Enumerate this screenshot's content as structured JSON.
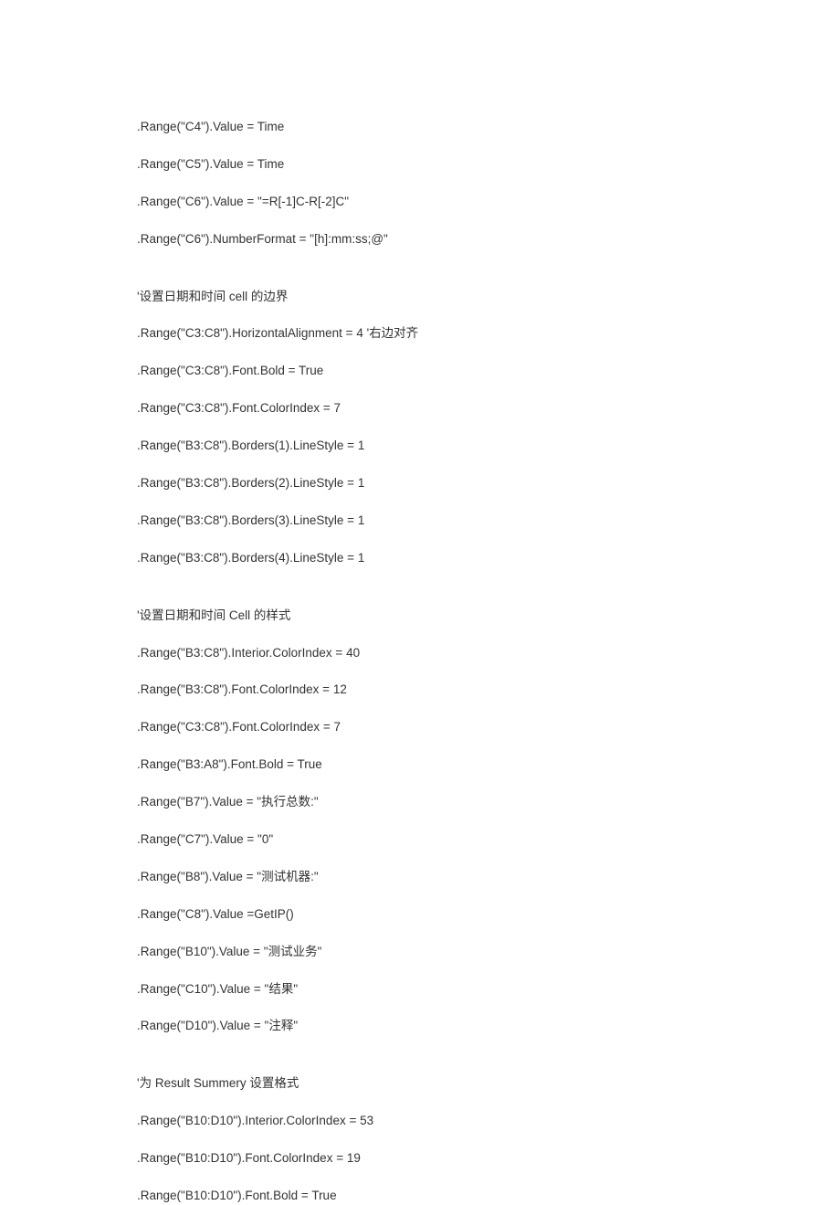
{
  "lines": [
    ".Range(\"C4\").Value = Time",
    ".Range(\"C5\").Value = Time",
    ".Range(\"C6\").Value = \"=R[-1]C-R[-2]C\"",
    ".Range(\"C6\").NumberFormat = \"[h]:mm:ss;@\"",
    "",
    "'设置日期和时间 cell 的边界",
    ".Range(\"C3:C8\").HorizontalAlignment = 4 '右边对齐",
    ".Range(\"C3:C8\").Font.Bold = True",
    ".Range(\"C3:C8\").Font.ColorIndex = 7",
    ".Range(\"B3:C8\").Borders(1).LineStyle = 1",
    ".Range(\"B3:C8\").Borders(2).LineStyle = 1",
    ".Range(\"B3:C8\").Borders(3).LineStyle = 1",
    ".Range(\"B3:C8\").Borders(4).LineStyle = 1",
    "",
    "'设置日期和时间 Cell 的样式",
    ".Range(\"B3:C8\").Interior.ColorIndex = 40",
    ".Range(\"B3:C8\").Font.ColorIndex = 12",
    ".Range(\"C3:C8\").Font.ColorIndex = 7",
    ".Range(\"B3:A8\").Font.Bold = True",
    ".Range(\"B7\").Value = \"执行总数:\"",
    ".Range(\"C7\").Value = \"0\"",
    ".Range(\"B8\").Value = \"测试机器:\"",
    ".Range(\"C8\").Value =GetIP()",
    ".Range(\"B10\").Value = \"测试业务\"",
    ".Range(\"C10\").Value = \"结果\"",
    ".Range(\"D10\").Value = \"注释\"",
    "",
    "'为 Result Summery 设置格式",
    ".Range(\"B10:D10\").Interior.ColorIndex = 53",
    ".Range(\"B10:D10\").Font.ColorIndex = 19",
    ".Range(\"B10:D10\").Font.Bold = True"
  ]
}
